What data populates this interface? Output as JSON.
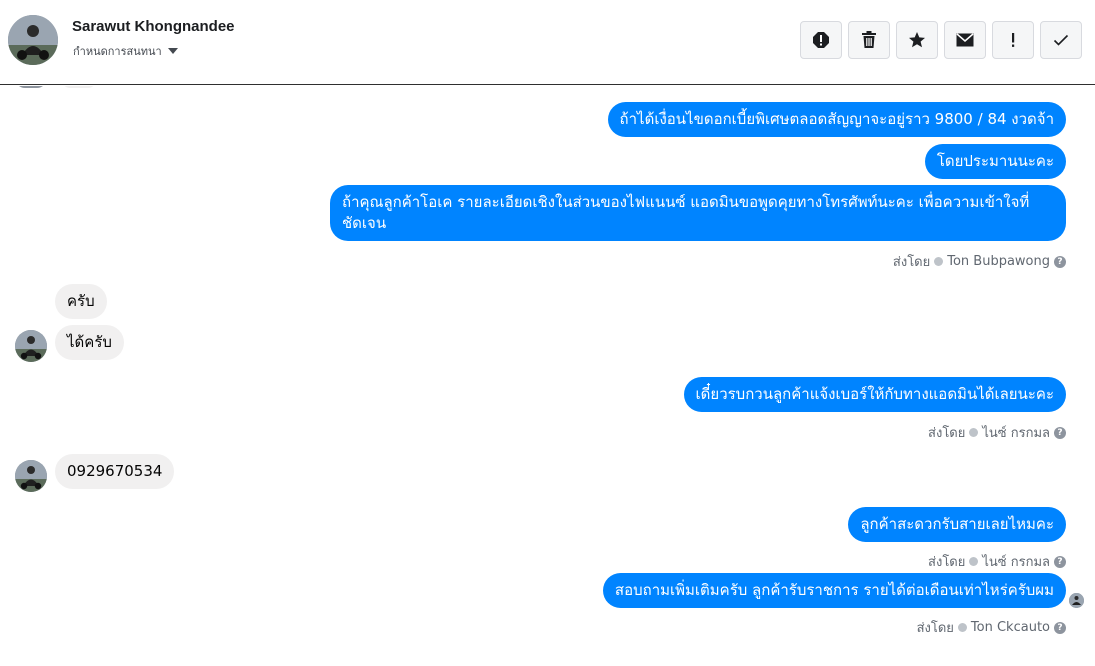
{
  "header": {
    "name": "Sarawut Khongnandee",
    "subtitle": "กำหนดการสนทนา",
    "actions": [
      "report-icon",
      "trash-icon",
      "star-icon",
      "envelope-icon",
      "exclamation-icon",
      "check-icon"
    ]
  },
  "messages": {
    "m1": "ถ้าได้เงื่อนไขดอกเบี้ยพิเศษตลอดสัญญาจะอยู่ราว 9800 / 84 งวดจ้า",
    "m2": "โดยประมานนะคะ",
    "m3": "ถ้าคุณลูกค้าโอเค รายละเอียดเชิงในส่วนของไฟแนนซ์ แอดมินขอพูดคุยทางโทรศัพท์นะคะ เพื่อความเข้าใจที่ชัดเจน",
    "m4": "ครับ",
    "m5": "ได้ครับ",
    "m6": "เดี๋ยวรบกวนลูกค้าแจ้งเบอร์ให้กับทางแอดมินได้เลยนะคะ",
    "m7": "0929670534",
    "m8": "ลูกค้าสะดวกรับสายเลยไหมคะ",
    "m9": "สอบถามเพิ่มเติมครับ ลูกค้ารับราชการ รายได้ต่อเดือนเท่าไหร่ครับผม"
  },
  "sent_by": {
    "prefix": "ส่งโดย",
    "s1": "Ton Bubpawong",
    "s2": "ไนซ์ กรกมล",
    "s3": "ไนซ์ กรกมล",
    "s4": "Ton Ckcauto",
    "help": "?"
  },
  "colors": {
    "outgoing": "#0084ff",
    "incoming": "#f1f0f0"
  }
}
